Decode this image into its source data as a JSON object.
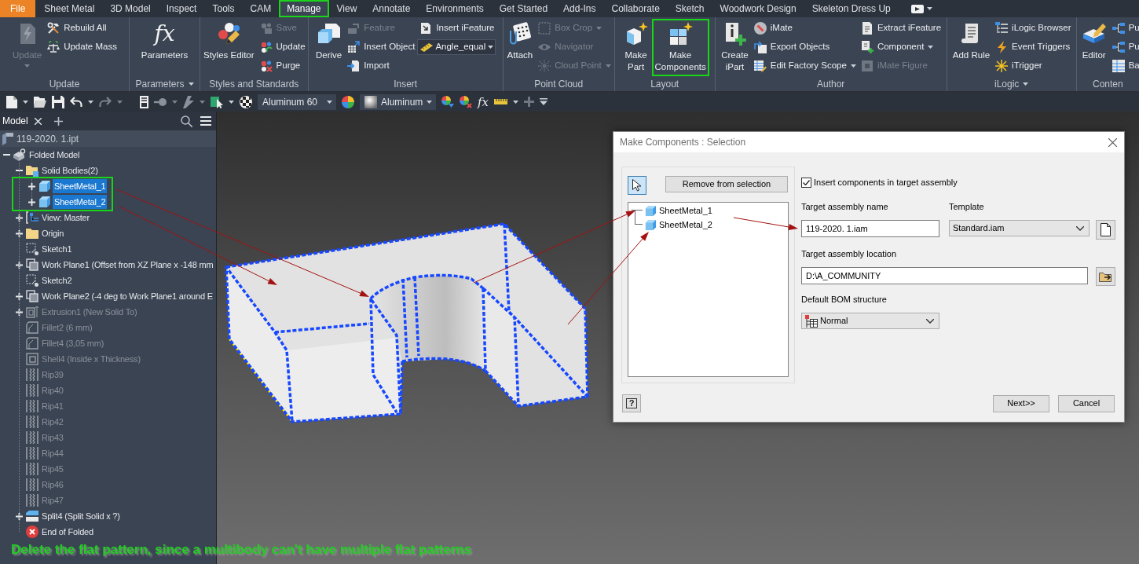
{
  "menu_tabs": [
    {
      "label": "File",
      "kind": "app",
      "selected": false,
      "highlighted": false
    },
    {
      "label": "Sheet Metal",
      "kind": "tab",
      "selected": false,
      "highlighted": false
    },
    {
      "label": "3D Model",
      "kind": "tab",
      "selected": false,
      "highlighted": false
    },
    {
      "label": "Inspect",
      "kind": "tab",
      "selected": false,
      "highlighted": false
    },
    {
      "label": "Tools",
      "kind": "tab",
      "selected": false,
      "highlighted": false
    },
    {
      "label": "CAM",
      "kind": "tab",
      "selected": false,
      "highlighted": false
    },
    {
      "label": "Manage",
      "kind": "tab",
      "selected": true,
      "highlighted": true
    },
    {
      "label": "View",
      "kind": "tab",
      "selected": false,
      "highlighted": false
    },
    {
      "label": "Annotate",
      "kind": "tab",
      "selected": false,
      "highlighted": false
    },
    {
      "label": "Environments",
      "kind": "tab",
      "selected": false,
      "highlighted": false
    },
    {
      "label": "Get Started",
      "kind": "tab",
      "selected": false,
      "highlighted": false
    },
    {
      "label": "Add-Ins",
      "kind": "tab",
      "selected": false,
      "highlighted": false
    },
    {
      "label": "Collaborate",
      "kind": "tab",
      "selected": false,
      "highlighted": false
    },
    {
      "label": "Sketch",
      "kind": "tab",
      "selected": false,
      "highlighted": false
    },
    {
      "label": "Woodwork Design",
      "kind": "tab",
      "selected": false,
      "highlighted": false
    },
    {
      "label": "Skeleton Dress Up",
      "kind": "tab",
      "selected": false,
      "highlighted": false
    }
  ],
  "ribbon": {
    "panels": [
      {
        "label": "Update",
        "menu": false,
        "columns": [
          {
            "kind": "large",
            "label": "Update",
            "disabled": true,
            "dropdown": true,
            "highlighted": false
          },
          {
            "kind": "stack",
            "items": [
              {
                "kind": "button",
                "label": "Rebuild All",
                "disabled": false,
                "dropdown": false
              },
              {
                "kind": "button",
                "label": "Update Mass",
                "disabled": false,
                "dropdown": false
              }
            ]
          }
        ]
      },
      {
        "label": "Parameters",
        "menu": true,
        "columns": [
          {
            "kind": "large",
            "label": "Parameters",
            "glyph": "fx",
            "disabled": false,
            "dropdown": false,
            "highlighted": false
          }
        ]
      },
      {
        "label": "Styles and Standards",
        "menu": false,
        "columns": [
          {
            "kind": "large",
            "label": "Styles Editor",
            "disabled": false,
            "dropdown": false,
            "highlighted": false
          },
          {
            "kind": "stack",
            "items": [
              {
                "kind": "button",
                "label": "Save",
                "disabled": true,
                "dropdown": false
              },
              {
                "kind": "button",
                "label": "Update",
                "disabled": false,
                "dropdown": false
              },
              {
                "kind": "button",
                "label": "Purge",
                "disabled": false,
                "dropdown": false
              }
            ]
          }
        ]
      },
      {
        "label": "Insert",
        "menu": false,
        "columns": [
          {
            "kind": "large",
            "label": "Derive",
            "disabled": false,
            "dropdown": false,
            "highlighted": false
          },
          {
            "kind": "stack",
            "items": [
              {
                "kind": "button",
                "label": "Feature",
                "disabled": true,
                "dropdown": false
              },
              {
                "kind": "button",
                "label": "Insert Object",
                "disabled": false,
                "dropdown": false
              },
              {
                "kind": "button",
                "label": "Import",
                "disabled": false,
                "dropdown": false
              }
            ]
          },
          {
            "kind": "stack",
            "items": [
              {
                "kind": "button",
                "label": "Insert iFeature",
                "disabled": false,
                "dropdown": false
              },
              {
                "kind": "combo",
                "value": "Angle_equal"
              }
            ]
          }
        ]
      },
      {
        "label": "Point Cloud",
        "menu": false,
        "columns": [
          {
            "kind": "large",
            "label": "Attach",
            "disabled": false,
            "dropdown": false,
            "highlighted": false
          },
          {
            "kind": "stack",
            "items": [
              {
                "kind": "button",
                "label": "Box Crop",
                "disabled": true,
                "dropdown": true
              },
              {
                "kind": "button",
                "label": "Navigator",
                "disabled": true,
                "dropdown": false
              },
              {
                "kind": "button",
                "label": "Cloud Point",
                "disabled": true,
                "dropdown": true
              }
            ]
          }
        ]
      },
      {
        "label": "Layout",
        "menu": false,
        "columns": [
          {
            "kind": "large",
            "label": "Make Part",
            "disabled": false,
            "dropdown": false,
            "highlighted": false
          },
          {
            "kind": "large",
            "label": "Make Components",
            "disabled": false,
            "dropdown": false,
            "highlighted": true
          }
        ]
      },
      {
        "label": "Author",
        "menu": false,
        "columns": [
          {
            "kind": "large",
            "label": "Create iPart",
            "disabled": false,
            "dropdown": false,
            "highlighted": false
          },
          {
            "kind": "stack",
            "items": [
              {
                "kind": "button",
                "label": "iMate",
                "disabled": false,
                "dropdown": false
              },
              {
                "kind": "button",
                "label": "Export Objects",
                "disabled": false,
                "dropdown": false
              },
              {
                "kind": "button",
                "label": "Edit Factory Scope",
                "disabled": false,
                "dropdown": true
              }
            ]
          },
          {
            "kind": "stack",
            "items": [
              {
                "kind": "button",
                "label": "Extract iFeature",
                "disabled": false,
                "dropdown": false
              },
              {
                "kind": "button",
                "label": "Component",
                "disabled": false,
                "dropdown": true
              },
              {
                "kind": "button",
                "label": "iMate Figure",
                "disabled": true,
                "dropdown": false
              }
            ]
          }
        ]
      },
      {
        "label": "iLogic",
        "menu": true,
        "columns": [
          {
            "kind": "large",
            "label": "Add Rule",
            "disabled": false,
            "dropdown": false,
            "highlighted": false
          },
          {
            "kind": "stack",
            "items": [
              {
                "kind": "button",
                "label": "iLogic Browser",
                "disabled": false,
                "dropdown": false
              },
              {
                "kind": "button",
                "label": "Event Triggers",
                "disabled": false,
                "dropdown": false
              },
              {
                "kind": "button",
                "label": "iTrigger",
                "disabled": false,
                "dropdown": false
              }
            ]
          }
        ]
      },
      {
        "label": "Conten",
        "menu": false,
        "columns": [
          {
            "kind": "large",
            "label": "Editor",
            "disabled": false,
            "dropdown": false,
            "highlighted": false
          },
          {
            "kind": "stack",
            "items": [
              {
                "kind": "button",
                "label": "Pu",
                "disabled": false,
                "dropdown": false
              },
              {
                "kind": "button",
                "label": "Pu",
                "disabled": false,
                "dropdown": false
              },
              {
                "kind": "button",
                "label": "Ba",
                "disabled": false,
                "dropdown": false
              }
            ]
          }
        ]
      }
    ]
  },
  "quick_access": {
    "material": "Aluminum 60",
    "appearance": "Aluminum",
    "glyph": "fx"
  },
  "browser": {
    "tabs": [
      {
        "label": "Model",
        "selected": true
      }
    ],
    "file": "119-2020. 1.ipt",
    "tree": [
      {
        "label": "Folded Model",
        "kind": "model",
        "expanded": true,
        "selected": false,
        "suppressed": false,
        "children": [
          {
            "label": "Solid Bodies(2)",
            "kind": "bodies",
            "expanded": true,
            "selected": false,
            "suppressed": false,
            "children_highlighted": true,
            "children": [
              {
                "label": "SheetMetal_1",
                "kind": "body",
                "expanded": false,
                "selected": true,
                "suppressed": false
              },
              {
                "label": "SheetMetal_2",
                "kind": "body",
                "expanded": false,
                "selected": true,
                "suppressed": false
              }
            ]
          },
          {
            "label": "View: Master",
            "kind": "view",
            "expanded": false,
            "selected": false,
            "suppressed": false
          },
          {
            "label": "Origin",
            "kind": "folder",
            "expanded": false,
            "selected": false,
            "suppressed": false
          },
          {
            "label": "Sketch1",
            "kind": "sketch",
            "selected": false,
            "suppressed": false
          },
          {
            "label": "Work Plane1 (Offset from XZ Plane x -148 mm",
            "kind": "plane",
            "expanded": false,
            "selected": false,
            "suppressed": false
          },
          {
            "label": "Sketch2",
            "kind": "sketch",
            "selected": false,
            "suppressed": false
          },
          {
            "label": "Work Plane2 (-4 deg to Work Plane1 around E",
            "kind": "plane",
            "expanded": false,
            "selected": false,
            "suppressed": false
          },
          {
            "label": "Extrusion1 (New Solid To)",
            "kind": "extrusion",
            "expanded": false,
            "selected": false,
            "suppressed": true
          },
          {
            "label": "Fillet2 (6 mm)",
            "kind": "fillet",
            "selected": false,
            "suppressed": true
          },
          {
            "label": "Fillet4 (3,05 mm)",
            "kind": "fillet",
            "selected": false,
            "suppressed": true
          },
          {
            "label": "Shell4 (Inside x Thickness)",
            "kind": "shell",
            "selected": false,
            "suppressed": true
          },
          {
            "label": "Rip39",
            "kind": "rip",
            "selected": false,
            "suppressed": true
          },
          {
            "label": "Rip40",
            "kind": "rip",
            "selected": false,
            "suppressed": true
          },
          {
            "label": "Rip41",
            "kind": "rip",
            "selected": false,
            "suppressed": true
          },
          {
            "label": "Rip42",
            "kind": "rip",
            "selected": false,
            "suppressed": true
          },
          {
            "label": "Rip43",
            "kind": "rip",
            "selected": false,
            "suppressed": true
          },
          {
            "label": "Rip44",
            "kind": "rip",
            "selected": false,
            "suppressed": true
          },
          {
            "label": "Rip45",
            "kind": "rip",
            "selected": false,
            "suppressed": true
          },
          {
            "label": "Rip46",
            "kind": "rip",
            "selected": false,
            "suppressed": true
          },
          {
            "label": "Rip47",
            "kind": "rip",
            "selected": false,
            "suppressed": true
          },
          {
            "label": "Split4 (Split Solid x ?)",
            "kind": "split",
            "expanded": false,
            "selected": false,
            "suppressed": false
          },
          {
            "label": "End of Folded",
            "kind": "end",
            "selected": false,
            "suppressed": false
          }
        ]
      }
    ]
  },
  "dialog": {
    "title": "Make Components : Selection",
    "select_tool": {
      "selected": true
    },
    "remove_button": "Remove from selection",
    "selection": [
      "SheetMetal_1",
      "SheetMetal_2"
    ],
    "insert_in_assembly": {
      "label": "Insert components in target assembly",
      "checked": true
    },
    "assembly_name": {
      "label": "Target assembly name",
      "value": "119-2020. 1.iam"
    },
    "template": {
      "label": "Template",
      "value": "Standard.iam"
    },
    "location": {
      "label": "Target assembly location",
      "value": "D:\\A_COMMUNITY"
    },
    "bom_structure": {
      "label": "Default BOM structure",
      "value": "Normal"
    },
    "help": "?",
    "buttons": [
      "Next>>",
      "Cancel"
    ]
  },
  "annotation": {
    "text": "Delete the flat pattern, since a multibody can't have multiple flat patterns"
  }
}
